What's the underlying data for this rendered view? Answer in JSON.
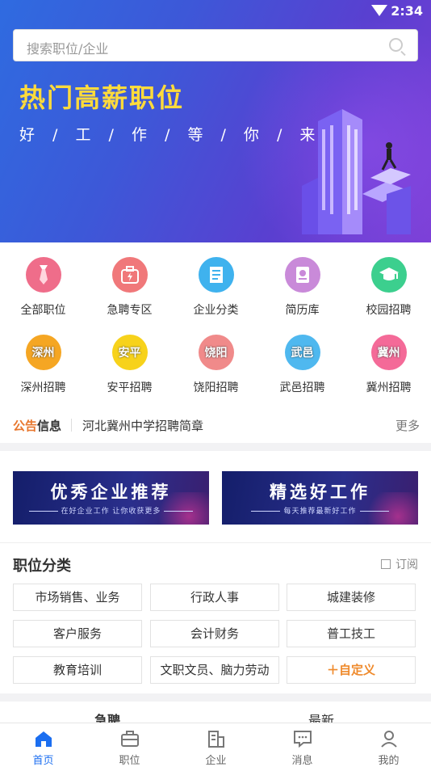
{
  "status": {
    "time": "2:34"
  },
  "search": {
    "placeholder": "搜索职位/企业"
  },
  "banner": {
    "title": "热门高薪职位",
    "subtitle": "好 / 工 / 作 / 等 / 你 / 来"
  },
  "categories": [
    {
      "label": "全部职位",
      "color": "#ef6d8a",
      "icon": "tie-icon",
      "badge": ""
    },
    {
      "label": "急聘专区",
      "color": "#f0787a",
      "icon": "urgent-bag-icon",
      "badge": ""
    },
    {
      "label": "企业分类",
      "color": "#3fb2ee",
      "icon": "building-doc-icon",
      "badge": ""
    },
    {
      "label": "简历库",
      "color": "#c98ad9",
      "icon": "resume-book-icon",
      "badge": ""
    },
    {
      "label": "校园招聘",
      "color": "#3ccf8e",
      "icon": "graduation-cap-icon",
      "badge": ""
    },
    {
      "label": "深州招聘",
      "color": "#f5a623",
      "icon": "city-badge-icon",
      "badge": "深州"
    },
    {
      "label": "安平招聘",
      "color": "#f7d21b",
      "icon": "city-badge-icon",
      "badge": "安平"
    },
    {
      "label": "饶阳招聘",
      "color": "#f08a8a",
      "icon": "city-badge-icon",
      "badge": "饶阳"
    },
    {
      "label": "武邑招聘",
      "color": "#4fb8ef",
      "icon": "city-badge-icon",
      "badge": "武邑"
    },
    {
      "label": "冀州招聘",
      "color": "#f46a98",
      "icon": "city-badge-icon",
      "badge": "冀州"
    }
  ],
  "notice": {
    "tag_a": "公告",
    "tag_b": "信息",
    "text": "河北冀州中学招聘简章",
    "more": "更多"
  },
  "promos": [
    {
      "title": "优秀企业推荐",
      "sub": "在好企业工作 让你收获更多"
    },
    {
      "title": "精选好工作",
      "sub": "每天推荐最新好工作"
    }
  ],
  "job_section": {
    "title": "职位分类",
    "subscribe": "订阅"
  },
  "jobs": [
    "市场销售、业务",
    "行政人事",
    "城建装修",
    "客户服务",
    "会计财务",
    "普工技工",
    "教育培训",
    "文职文员、脑力劳动",
    "＋自定义"
  ],
  "tabs": [
    "急聘",
    "最新"
  ],
  "nav": [
    {
      "label": "首页",
      "icon": "home-icon",
      "active": true
    },
    {
      "label": "职位",
      "icon": "briefcase-icon",
      "active": false
    },
    {
      "label": "企业",
      "icon": "building-icon",
      "active": false
    },
    {
      "label": "消息",
      "icon": "message-icon",
      "active": false
    },
    {
      "label": "我的",
      "icon": "profile-icon",
      "active": false
    }
  ],
  "colors": {
    "accent": "#1b6ef0",
    "hot_title": "#ffdb3b",
    "custom": "#ef8a2c"
  }
}
